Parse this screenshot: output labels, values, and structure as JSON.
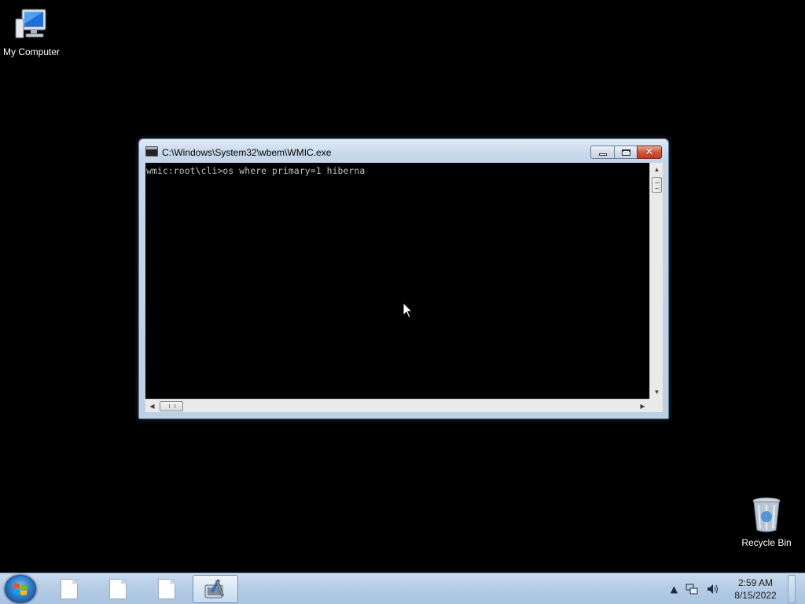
{
  "desktop": {
    "icons": [
      {
        "label": "My Computer"
      },
      {
        "label": "Recycle Bin"
      }
    ]
  },
  "window": {
    "title": "C:\\Windows\\System32\\wbem\\WMIC.exe",
    "console_lines": [
      "wmic:root\\cli>os where primary=1 hiberna"
    ]
  },
  "taskbar": {
    "items": [
      {
        "icon": "document-icon",
        "active": false
      },
      {
        "icon": "document-icon",
        "active": false
      },
      {
        "icon": "document-icon",
        "active": false
      },
      {
        "icon": "wmic-tools-icon",
        "active": true
      }
    ],
    "tray": {
      "time": "2:59 AM",
      "date": "8/15/2022"
    }
  },
  "colors": {
    "desktop_background": "#000000",
    "console_text": "#c0c0c0",
    "close_button": "#c8462a"
  }
}
